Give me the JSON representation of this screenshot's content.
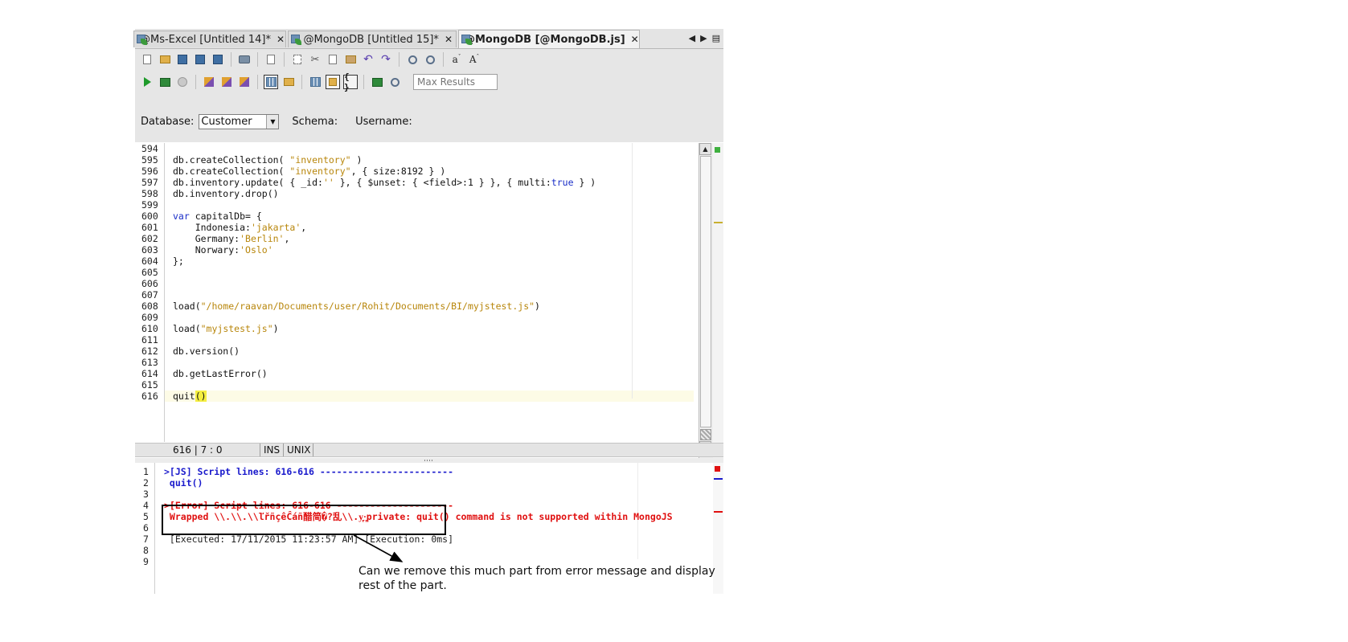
{
  "tabs": [
    {
      "label": "@Ms-Excel [Untitled 14]*",
      "active": false
    },
    {
      "label": "@MongoDB [Untitled 15]*",
      "active": false
    },
    {
      "label": "@MongoDB [@MongoDB.js]",
      "active": true
    }
  ],
  "toolbar": {
    "max_results_placeholder": "Max Results",
    "database_label": "Database:",
    "database_value": "Customer",
    "schema_label": "Schema:",
    "username_label": "Username:"
  },
  "editor": {
    "line_numbers": [
      "594",
      "595",
      "596",
      "597",
      "598",
      "599",
      "600",
      "601",
      "602",
      "603",
      "604",
      "605",
      "606",
      "607",
      "608",
      "609",
      "610",
      "611",
      "612",
      "613",
      "614",
      "615",
      "616"
    ],
    "lines": [
      "",
      "db.createCollection( \"inventory\" )",
      "db.createCollection( \"inventory\", { size:8192 } )",
      "db.inventory.update( { _id:'' }, { $unset: { <field>:1 } }, { multi:true } )",
      "db.inventory.drop()",
      "",
      "var capitalDb= {",
      "    Indonesia:'jakarta',",
      "    Germany:'Berlin',",
      "    Norwary:'Oslo'",
      "};",
      "",
      "",
      "",
      "load(\"/home/raavan/Documents/user/Rohit/Documents/BI/myjstest.js\")",
      "",
      "load(\"myjstest.js\")",
      "",
      "db.version()",
      "",
      "db.getLastError()",
      "",
      "quit()"
    ]
  },
  "status": {
    "position": "616 | 7 : 0",
    "mode": "INS",
    "line_ending": "UNIX"
  },
  "output": {
    "line_numbers": [
      "1",
      "2",
      "3",
      "4",
      "5",
      "6",
      "7",
      "8",
      "9"
    ],
    "lines": [
      {
        "text": ">[JS] Script lines: 616-616 ------------------------",
        "style": "blue"
      },
      {
        "text": " quit()",
        "style": "blue"
      },
      {
        "text": "",
        "style": "black"
      },
      {
        "text": ">[Error] Script lines: 616-616 ---------------------",
        "style": "red"
      },
      {
        "text": " Wrapped \\\\.\\\\.\\\\ľřñçêĈáñ醋简�?乱\\\\.y᷊᷊·᷊private: quit() command is not supported within MongoJS",
        "style": "red"
      },
      {
        "text": "",
        "style": "black"
      },
      {
        "text": " [Executed: 17/11/2015 11:23:57 AM] [Execution: 0ms]",
        "style": "black"
      },
      {
        "text": "",
        "style": "black"
      },
      {
        "text": "",
        "style": "black"
      }
    ]
  },
  "annotation": {
    "line1": "Can we remove this much part from error message and display",
    "line2": "rest of the part."
  },
  "colors": {
    "string": "#b8860b",
    "keyword": "#1a2ec8",
    "info": "#1a1acc",
    "error": "#e01010"
  }
}
